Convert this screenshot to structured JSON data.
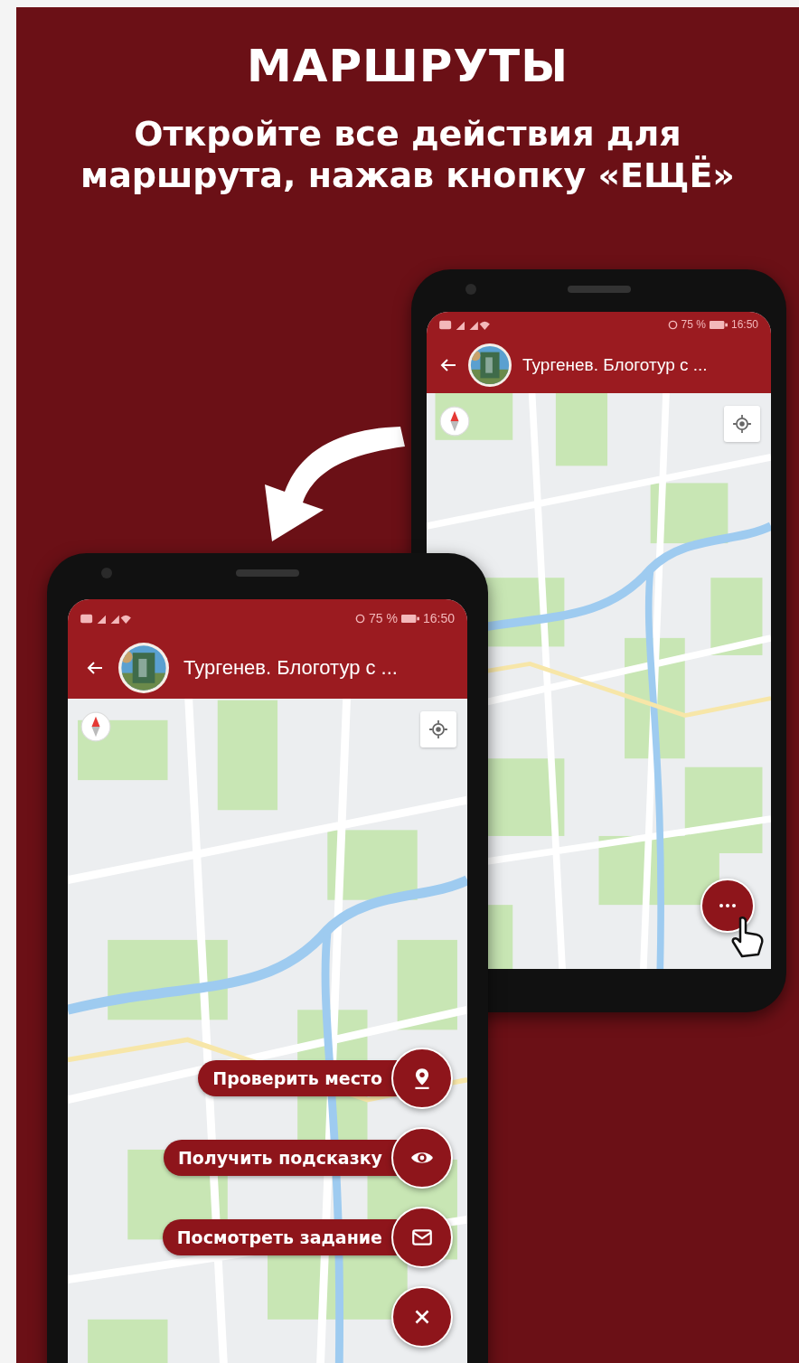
{
  "heading": "МАРШРУТЫ",
  "subheading": "Откройте все действия для маршрута, нажав кнопку «ЕЩЁ»",
  "phones": [
    {
      "battery": "75 %",
      "time": "16:50",
      "title": "Тургенев. Блоготур с ...",
      "fab_open": false
    },
    {
      "battery": "75 %",
      "time": "16:50",
      "title": "Тургенев. Блоготур с ...",
      "fab_open": true,
      "actions": [
        {
          "label": "Проверить место",
          "kind": "pin"
        },
        {
          "label": "Получить подсказку",
          "kind": "eye"
        },
        {
          "label": "Посмотреть задание",
          "kind": "mail"
        }
      ]
    }
  ]
}
